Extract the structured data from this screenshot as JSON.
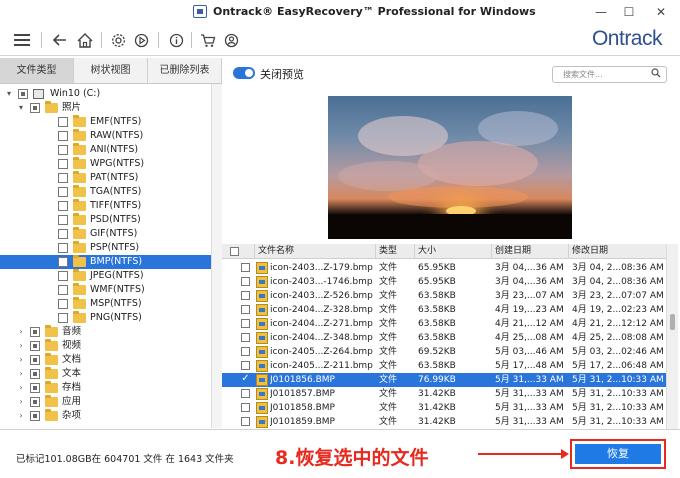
{
  "window": {
    "title": "Ontrack® EasyRecovery™ Professional for Windows",
    "minimize": "—",
    "maximize": "☐",
    "close": "✕"
  },
  "toolbar": {
    "icons": [
      "menu-icon",
      "back-icon",
      "home-icon",
      "settings-icon",
      "play-icon",
      "info-icon",
      "cart-icon",
      "user-icon"
    ],
    "brand": "Ontrack"
  },
  "left_tabs": [
    {
      "label": "文件类型",
      "active": true
    },
    {
      "label": "树状视图",
      "active": false
    },
    {
      "label": "已删除列表",
      "active": false
    }
  ],
  "tree": [
    {
      "label": "Win10 (C:)",
      "level": 0,
      "type": "drive",
      "expanded": true
    },
    {
      "label": "照片",
      "level": 1,
      "type": "folder",
      "expanded": true
    },
    {
      "label": "EMF(NTFS)",
      "level": 2,
      "type": "folder"
    },
    {
      "label": "RAW(NTFS)",
      "level": 2,
      "type": "folder"
    },
    {
      "label": "ANI(NTFS)",
      "level": 2,
      "type": "folder"
    },
    {
      "label": "WPG(NTFS)",
      "level": 2,
      "type": "folder"
    },
    {
      "label": "PAT(NTFS)",
      "level": 2,
      "type": "folder"
    },
    {
      "label": "TGA(NTFS)",
      "level": 2,
      "type": "folder"
    },
    {
      "label": "TIFF(NTFS)",
      "level": 2,
      "type": "folder"
    },
    {
      "label": "PSD(NTFS)",
      "level": 2,
      "type": "folder"
    },
    {
      "label": "GIF(NTFS)",
      "level": 2,
      "type": "folder"
    },
    {
      "label": "PSP(NTFS)",
      "level": 2,
      "type": "folder"
    },
    {
      "label": "BMP(NTFS)",
      "level": 2,
      "type": "folder",
      "selected": true
    },
    {
      "label": "JPEG(NTFS)",
      "level": 2,
      "type": "folder"
    },
    {
      "label": "WMF(NTFS)",
      "level": 2,
      "type": "folder"
    },
    {
      "label": "MSP(NTFS)",
      "level": 2,
      "type": "folder"
    },
    {
      "label": "PNG(NTFS)",
      "level": 2,
      "type": "folder"
    },
    {
      "label": "音频",
      "level": 1,
      "type": "folder",
      "collapsed": true
    },
    {
      "label": "视频",
      "level": 1,
      "type": "folder",
      "collapsed": true
    },
    {
      "label": "文档",
      "level": 1,
      "type": "folder",
      "collapsed": true
    },
    {
      "label": "文本",
      "level": 1,
      "type": "folder",
      "collapsed": true
    },
    {
      "label": "存档",
      "level": 1,
      "type": "folder",
      "collapsed": true
    },
    {
      "label": "应用",
      "level": 1,
      "type": "folder",
      "collapsed": true
    },
    {
      "label": "杂项",
      "level": 1,
      "type": "folder",
      "collapsed": true
    }
  ],
  "preview": {
    "toggle_label": "关闭预览",
    "toggle_on": true,
    "search_placeholder": "搜索文件..."
  },
  "table": {
    "headers": [
      "文件名称",
      "类型",
      "大小",
      "创建日期",
      "修改日期"
    ],
    "rows": [
      {
        "name": "icon-2403...Z-179.bmp",
        "type": "文件",
        "size": "65.95KB",
        "created": "3月 04,...36 AM",
        "modified": "3月 04, 2...08:36 AM",
        "checked": false,
        "selected": false
      },
      {
        "name": "icon-2403...-1746.bmp",
        "type": "文件",
        "size": "65.95KB",
        "created": "3月 04,...36 AM",
        "modified": "3月 04, 2...08:36 AM",
        "checked": false,
        "selected": false
      },
      {
        "name": "icon-2403...Z-526.bmp",
        "type": "文件",
        "size": "63.58KB",
        "created": "3月 23,...07 AM",
        "modified": "3月 23, 2...07:07 AM",
        "checked": false,
        "selected": false
      },
      {
        "name": "icon-2404...Z-328.bmp",
        "type": "文件",
        "size": "63.58KB",
        "created": "4月 19,...23 AM",
        "modified": "4月 19, 2...02:23 AM",
        "checked": false,
        "selected": false
      },
      {
        "name": "icon-2404...Z-271.bmp",
        "type": "文件",
        "size": "63.58KB",
        "created": "4月 21,...12 AM",
        "modified": "4月 21, 2...12:12 AM",
        "checked": false,
        "selected": false
      },
      {
        "name": "icon-2404...Z-348.bmp",
        "type": "文件",
        "size": "63.58KB",
        "created": "4月 25,...08 AM",
        "modified": "4月 25, 2...08:08 AM",
        "checked": false,
        "selected": false
      },
      {
        "name": "icon-2405...Z-264.bmp",
        "type": "文件",
        "size": "69.52KB",
        "created": "5月 03,...46 AM",
        "modified": "5月 03, 2...02:46 AM",
        "checked": false,
        "selected": false
      },
      {
        "name": "icon-2405...Z-211.bmp",
        "type": "文件",
        "size": "63.58KB",
        "created": "5月 17,...48 AM",
        "modified": "5月 17, 2...06:48 AM",
        "checked": false,
        "selected": false
      },
      {
        "name": "J0101856.BMP",
        "type": "文件",
        "size": "76.99KB",
        "created": "5月 31,...33 AM",
        "modified": "5月 31, 2...10:33 AM",
        "checked": true,
        "selected": true
      },
      {
        "name": "J0101857.BMP",
        "type": "文件",
        "size": "31.42KB",
        "created": "5月 31,...33 AM",
        "modified": "5月 31, 2...10:33 AM",
        "checked": false,
        "selected": false
      },
      {
        "name": "J0101858.BMP",
        "type": "文件",
        "size": "31.42KB",
        "created": "5月 31,...33 AM",
        "modified": "5月 31, 2...10:33 AM",
        "checked": false,
        "selected": false
      },
      {
        "name": "J0101859.BMP",
        "type": "文件",
        "size": "31.42KB",
        "created": "5月 31,...33 AM",
        "modified": "5月 31, 2...10:33 AM",
        "checked": false,
        "selected": false
      }
    ]
  },
  "status": {
    "text": "已标记101.08GB在 604701 文件 在 1643 文件夹",
    "annotation": "8.恢复选中的文件",
    "recover_button": "恢复",
    "accent": "#1f7ae6",
    "annotation_color": "#e8291e"
  }
}
